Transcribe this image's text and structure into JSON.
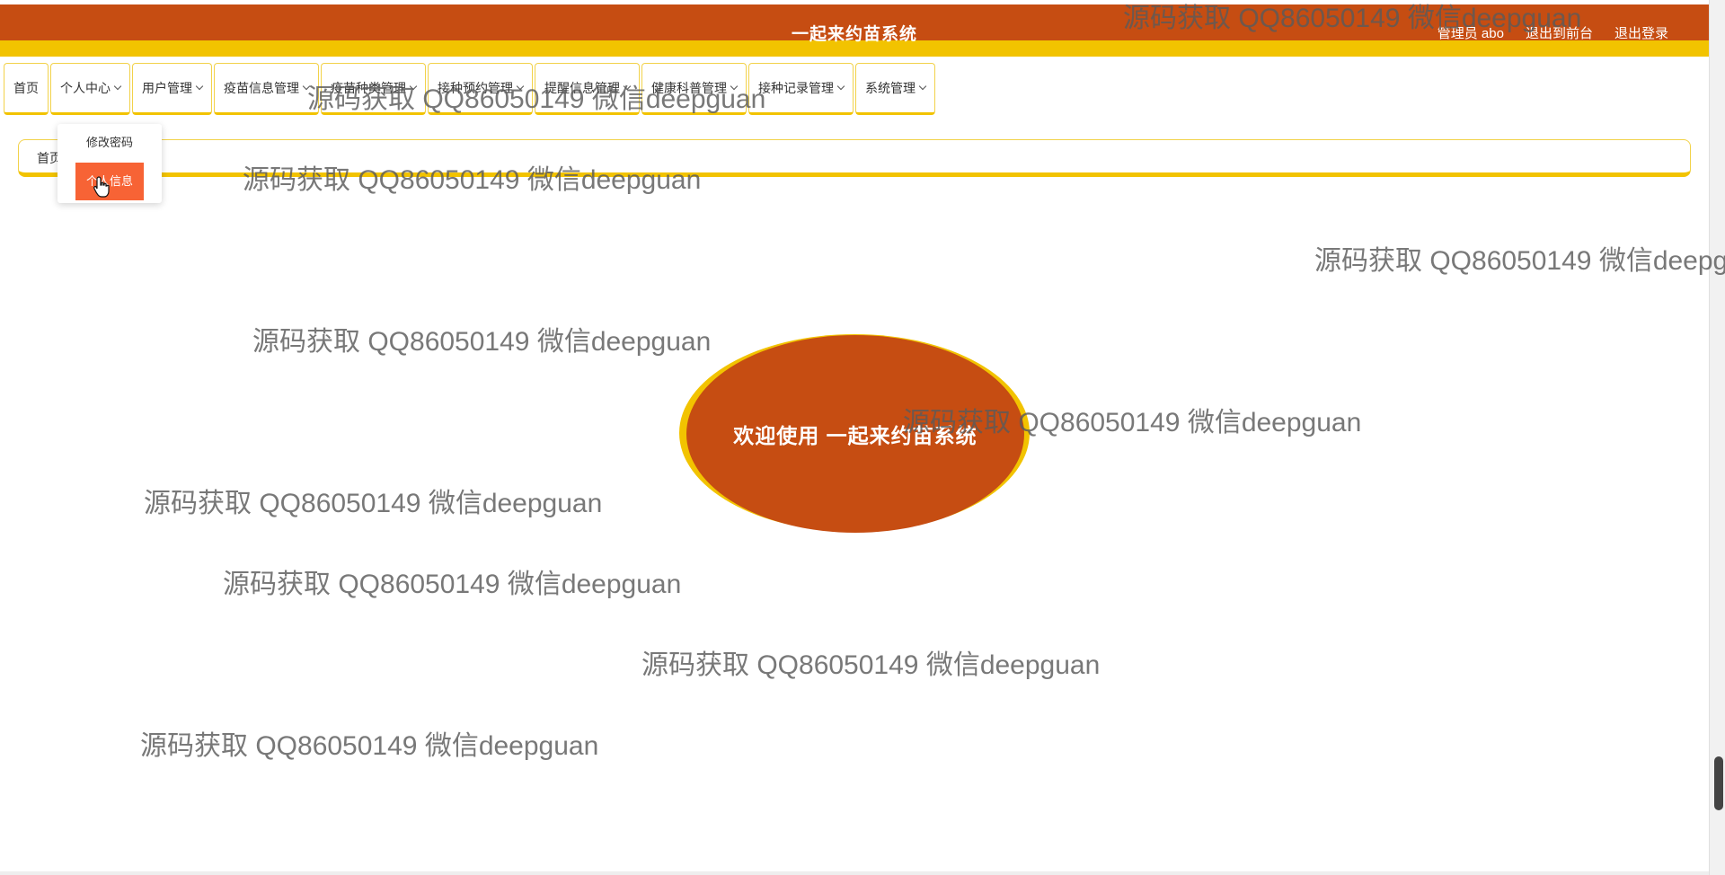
{
  "header": {
    "title": "一起来约苗系统",
    "admin_label": "管理员 abo",
    "to_front_label": "退出到前台",
    "logout_label": "退出登录"
  },
  "nav": {
    "items": [
      {
        "label": "首页",
        "has_dropdown": false
      },
      {
        "label": "个人中心",
        "has_dropdown": true
      },
      {
        "label": "用户管理",
        "has_dropdown": true
      },
      {
        "label": "疫苗信息管理",
        "has_dropdown": true
      },
      {
        "label": "疫苗种类管理",
        "has_dropdown": true
      },
      {
        "label": "接种预约管理",
        "has_dropdown": true
      },
      {
        "label": "提醒信息管理",
        "has_dropdown": true
      },
      {
        "label": "健康科普管理",
        "has_dropdown": true
      },
      {
        "label": "接种记录管理",
        "has_dropdown": true
      },
      {
        "label": "系统管理",
        "has_dropdown": true
      }
    ]
  },
  "dropdown": {
    "items": [
      "修改密码",
      "个人信息"
    ],
    "active_index": 1
  },
  "breadcrumb": {
    "text": "首页"
  },
  "welcome": {
    "text": "欢迎使用 一起来约苗系统"
  },
  "watermark": {
    "text": "源码获取 QQ86050149 微信deepguan"
  },
  "colors": {
    "primary": "#c64d12",
    "accent": "#f2c300",
    "active_item": "#f76335"
  }
}
